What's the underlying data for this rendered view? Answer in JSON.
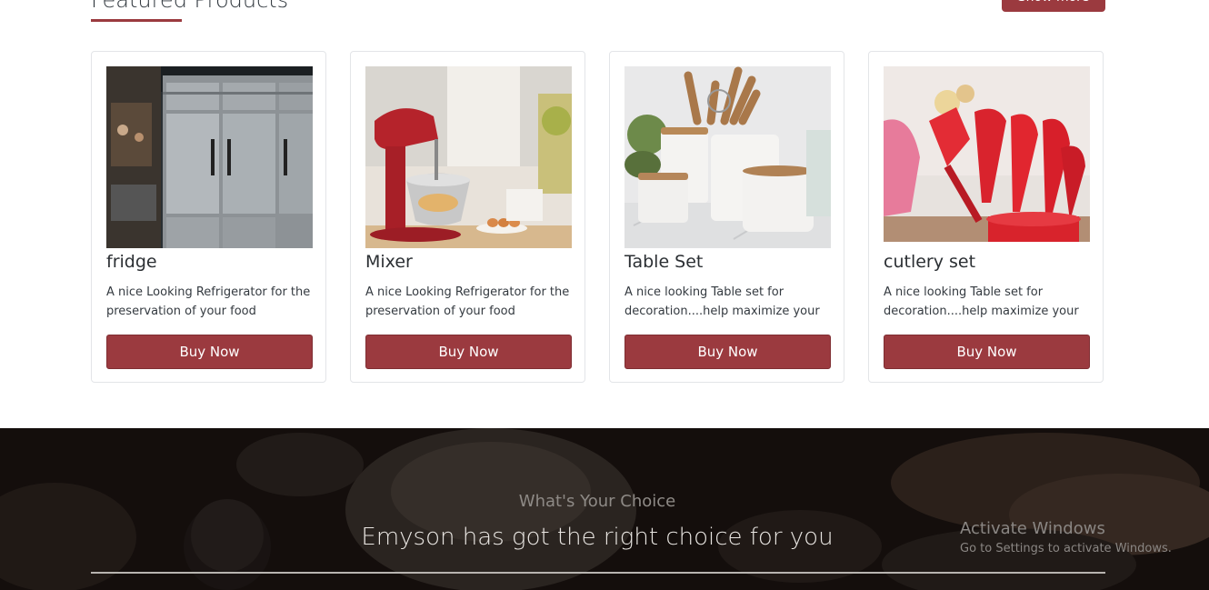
{
  "section": {
    "title": "Featured Products",
    "show_more_label": "Show more"
  },
  "products": [
    {
      "name": "fridge",
      "description": "A nice Looking Refrigerator for the preservation of your food",
      "buy_label": "Buy Now",
      "image": "stainless-steel-refrigerator-photo"
    },
    {
      "name": "Mixer",
      "description": "A nice Looking Refrigerator for the preservation of your food",
      "buy_label": "Buy Now",
      "image": "red-stand-mixer-photo"
    },
    {
      "name": "Table Set",
      "description": "A nice looking Table set for decoration....help maximize your",
      "buy_label": "Buy Now",
      "image": "kitchen-utensils-jar-set-photo"
    },
    {
      "name": "cutlery set",
      "description": "A nice looking Table set for decoration....help maximize your",
      "buy_label": "Buy Now",
      "image": "red-silicone-utensils-photo"
    }
  ],
  "banner": {
    "tagline": "What's Your Choice",
    "headline": "Emyson has got the right choice for you"
  },
  "watermark": {
    "title": "Activate Windows",
    "subtitle": "Go to Settings to activate Windows."
  },
  "colors": {
    "accent": "#9b3a3f",
    "banner_bg": "#17120f"
  }
}
